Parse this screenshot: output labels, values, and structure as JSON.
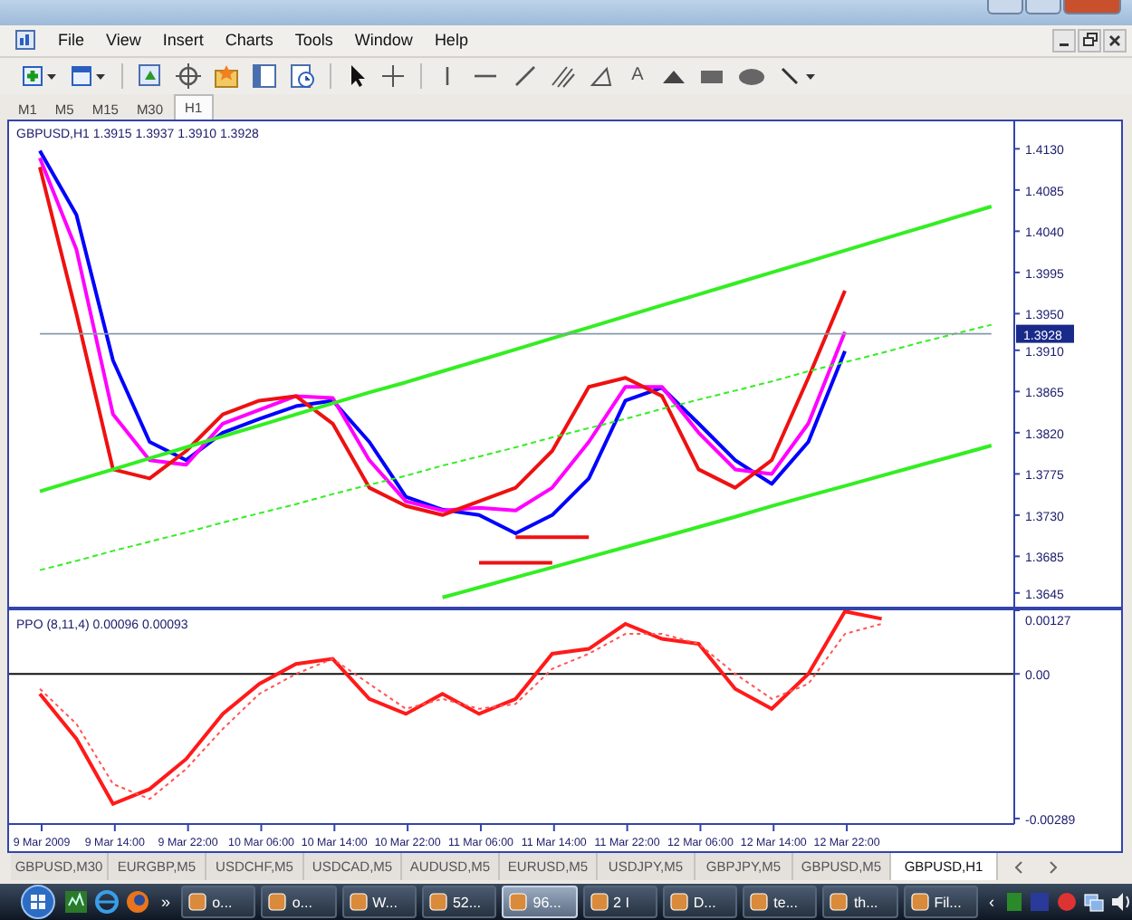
{
  "window": {
    "menu": [
      "File",
      "View",
      "Insert",
      "Charts",
      "Tools",
      "Window",
      "Help"
    ]
  },
  "toolbar": {
    "text_tool": "A"
  },
  "timeframes": [
    {
      "label": "M1",
      "selected": false
    },
    {
      "label": "M5",
      "selected": false
    },
    {
      "label": "M15",
      "selected": false
    },
    {
      "label": "M30",
      "selected": false
    },
    {
      "label": "H1",
      "selected": true
    }
  ],
  "price_chart": {
    "title": "GBPUSD,H1  1.3915 1.3937 1.3910 1.3928",
    "current_price": "1.3928",
    "chart_data": {
      "type": "line",
      "categories": [
        null,
        null,
        null,
        null,
        null,
        null,
        null,
        null,
        null,
        null,
        null,
        null,
        null,
        null,
        null,
        null,
        null,
        null,
        null,
        null,
        null,
        null,
        null,
        null,
        null,
        null,
        null
      ],
      "ylim": [
        1.363,
        1.416
      ],
      "yticks": [
        {
          "value": 1.413,
          "label": "1.4130"
        },
        1.4085,
        {
          "value": 1.404,
          "label": "1.4040"
        },
        1.3995,
        {
          "value": 1.395,
          "label": "1.3950"
        },
        {
          "value": 1.391,
          "label": "1.3910"
        },
        1.3865,
        {
          "value": 1.382,
          "label": "1.3820"
        },
        1.3775,
        {
          "value": 1.373,
          "label": "1.3730"
        },
        1.3685,
        1.3645
      ],
      "series": [
        {
          "color": "#0000ff",
          "values": [
            1.4128,
            1.4058,
            1.3899,
            1.381,
            1.379,
            1.382,
            1.3835,
            1.3849,
            1.3855,
            1.381,
            1.375,
            1.3736,
            1.373,
            1.371,
            1.373,
            1.377,
            1.3855,
            1.3869,
            1.383,
            1.379,
            1.3764,
            1.381,
            1.3909,
            null,
            null,
            null,
            null
          ]
        },
        {
          "color": "#ff00ff",
          "values": [
            1.412,
            1.402,
            1.384,
            1.379,
            1.3785,
            1.383,
            1.3845,
            1.386,
            1.3858,
            1.379,
            1.3745,
            1.3735,
            1.3738,
            1.3735,
            1.376,
            1.381,
            1.387,
            1.387,
            1.382,
            1.378,
            1.3775,
            1.383,
            1.393,
            null,
            null,
            null,
            null
          ]
        },
        {
          "color": "#ee1111",
          "values": [
            1.411,
            1.395,
            1.378,
            1.377,
            1.38,
            1.384,
            1.3855,
            1.386,
            1.383,
            1.376,
            1.374,
            1.373,
            1.3745,
            1.376,
            1.38,
            1.387,
            1.388,
            1.386,
            1.378,
            1.376,
            1.379,
            1.388,
            1.3975,
            null,
            null,
            null,
            null
          ]
        },
        {
          "color": "#33ee22",
          "values": [
            1.3756,
            1.3768,
            1.378,
            1.3792,
            1.3804,
            1.3816,
            1.3828,
            1.384,
            1.3852,
            1.3864,
            1.3875,
            1.3887,
            1.3899,
            1.3911,
            1.3923,
            1.3935,
            1.3947,
            1.3959,
            1.3971,
            1.3983,
            1.3995,
            1.4007,
            1.4019,
            1.4031,
            1.4043,
            1.4055,
            1.4067
          ]
        },
        {
          "color": "#33ee22",
          "line_style": "dashed",
          "values": [
            1.367,
            1.368,
            1.3691,
            1.3701,
            1.3711,
            1.3722,
            1.3732,
            1.3742,
            1.3753,
            1.3763,
            1.3773,
            1.3784,
            1.3794,
            1.3804,
            1.3815,
            1.3825,
            1.3835,
            1.3846,
            1.3856,
            1.3866,
            1.3876,
            1.3887,
            1.3897,
            1.3907,
            1.3918,
            1.3928,
            1.3938
          ]
        },
        {
          "color": "#33ee22",
          "values": [
            null,
            null,
            null,
            null,
            null,
            null,
            null,
            null,
            null,
            null,
            null,
            1.364,
            1.3651,
            1.3662,
            1.3673,
            1.3684,
            1.3695,
            1.3706,
            1.3717,
            1.3728,
            1.374,
            1.3751,
            1.3762,
            1.3773,
            1.3784,
            1.3795,
            1.3806
          ]
        },
        {
          "color": "#ee1111",
          "values": [
            null,
            null,
            null,
            null,
            null,
            null,
            null,
            null,
            null,
            null,
            null,
            null,
            null,
            1.3706,
            1.3706,
            1.3706,
            null,
            null,
            null,
            null,
            null,
            null,
            null,
            null,
            null,
            null,
            null
          ]
        },
        {
          "color": "#ee1111",
          "values": [
            null,
            null,
            null,
            null,
            null,
            null,
            null,
            null,
            null,
            null,
            null,
            null,
            1.3678,
            1.3678,
            1.3678,
            null,
            null,
            null,
            null,
            null,
            null,
            null,
            null,
            null,
            null,
            null,
            null
          ]
        },
        {
          "color": "#8899aa",
          "values": [
            1.3928,
            1.3928,
            1.3928,
            1.3928,
            1.3928,
            1.3928,
            1.3928,
            1.3928,
            1.3928,
            1.3928,
            1.3928,
            1.3928,
            1.3928,
            1.3928,
            1.3928,
            1.3928,
            1.3928,
            1.3928,
            1.3928,
            1.3928,
            1.3928,
            1.3928,
            1.3928,
            1.3928,
            1.3928,
            1.3928,
            1.3928
          ]
        }
      ]
    }
  },
  "ppo_chart": {
    "title": "PPO (8,11,4) 0.00096 0.00093",
    "chart_data": {
      "type": "line",
      "categories": [
        "9 Mar 2009",
        null,
        "9 Mar 14:00",
        null,
        "9 Mar 22:00",
        null,
        "10 Mar 06:00",
        null,
        "10 Mar 14:00",
        null,
        "10 Mar 22:00",
        null,
        "11 Mar 06:00",
        null,
        "11 Mar 14:00",
        null,
        "11 Mar 22:00",
        null,
        "12 Mar 06:00",
        null,
        "12 Mar 14:00",
        null,
        "12 Mar 22:00",
        null
      ],
      "ylim": [
        -0.003,
        0.00127
      ],
      "yticks": [
        {
          "value": 0.00127,
          "label": "0.00127"
        },
        {
          "value": 0,
          "label": "0.00"
        },
        {
          "value": -0.00289,
          "label": "-0.00289"
        }
      ],
      "series": [
        {
          "color": "#ff1a1a",
          "values": [
            -0.0004,
            -0.0013,
            -0.0026,
            -0.0023,
            -0.0017,
            -0.0008,
            -0.0002,
            0.0002,
            0.0003,
            -0.0005,
            -0.0008,
            -0.0004,
            -0.0008,
            -0.0005,
            0.0004,
            0.0005,
            0.001,
            0.0007,
            0.0006,
            -0.0003,
            -0.0007,
            0.0,
            0.00125,
            0.0011
          ]
        },
        {
          "color": "#ff5555",
          "line_style": "dashed",
          "values": [
            -0.0003,
            -0.001,
            -0.0022,
            -0.0025,
            -0.0019,
            -0.0011,
            -0.0004,
            0.0,
            0.0003,
            -0.0002,
            -0.0007,
            -0.0005,
            -0.0007,
            -0.0006,
            0.0001,
            0.0004,
            0.0008,
            0.0008,
            0.0006,
            0.0,
            -0.0005,
            -0.0002,
            0.0008,
            0.001
          ]
        }
      ]
    }
  },
  "chart_tabs": [
    {
      "label": "GBPUSD,M30",
      "selected": false
    },
    {
      "label": "EURGBP,M5",
      "selected": false
    },
    {
      "label": "USDCHF,M5",
      "selected": false
    },
    {
      "label": "USDCAD,M5",
      "selected": false
    },
    {
      "label": "AUDUSD,M5",
      "selected": false
    },
    {
      "label": "EURUSD,M5",
      "selected": false
    },
    {
      "label": "USDJPY,M5",
      "selected": false
    },
    {
      "label": "GBPJPY,M5",
      "selected": false
    },
    {
      "label": "GBPUSD,M5",
      "selected": false
    },
    {
      "label": "GBPUSD,H1",
      "selected": true
    }
  ],
  "taskbar": {
    "quick_launch_more": "»",
    "tray_expand": "‹",
    "buttons": [
      {
        "label": "o...",
        "selected": false
      },
      {
        "label": "o...",
        "selected": false
      },
      {
        "label": "W...",
        "selected": false
      },
      {
        "label": "52...",
        "selected": false
      },
      {
        "label": "96...",
        "selected": true
      },
      {
        "label": "2 I",
        "selected": false
      },
      {
        "label": "D...",
        "selected": false
      },
      {
        "label": "te...",
        "selected": false
      },
      {
        "label": "th...",
        "selected": false
      },
      {
        "label": "Fil...",
        "selected": false
      }
    ]
  }
}
